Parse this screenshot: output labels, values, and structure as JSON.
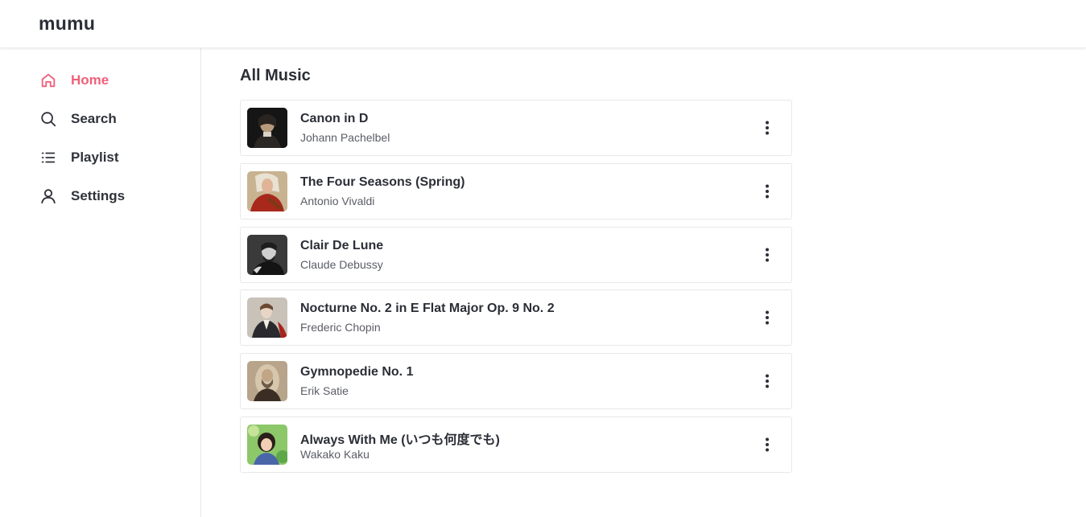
{
  "app": {
    "logo": "mumu"
  },
  "colors": {
    "accent": "#f0607a",
    "text": "#2b2e36"
  },
  "sidebar": {
    "items": [
      {
        "label": "Home",
        "icon": "home-icon",
        "active": true
      },
      {
        "label": "Search",
        "icon": "search-icon",
        "active": false
      },
      {
        "label": "Playlist",
        "icon": "list-icon",
        "active": false
      },
      {
        "label": "Settings",
        "icon": "user-icon",
        "active": false
      }
    ]
  },
  "main": {
    "title": "All Music",
    "tracks": [
      {
        "title": "Canon in D",
        "artist": "Johann Pachelbel",
        "cover": "portrait-dark"
      },
      {
        "title": "The Four Seasons (Spring)",
        "artist": "Antonio Vivaldi",
        "cover": "portrait-red-violin"
      },
      {
        "title": "Clair De Lune",
        "artist": "Claude Debussy",
        "cover": "portrait-bw"
      },
      {
        "title": "Nocturne No. 2 in E Flat Major Op. 9 No. 2",
        "artist": "Frederic Chopin",
        "cover": "portrait-light"
      },
      {
        "title": "Gymnopedie No. 1",
        "artist": "Erik Satie",
        "cover": "portrait-sepia"
      },
      {
        "title": "Always With Me (いつも何度でも)",
        "artist": "Wakako Kaku",
        "cover": "portrait-green"
      }
    ]
  }
}
